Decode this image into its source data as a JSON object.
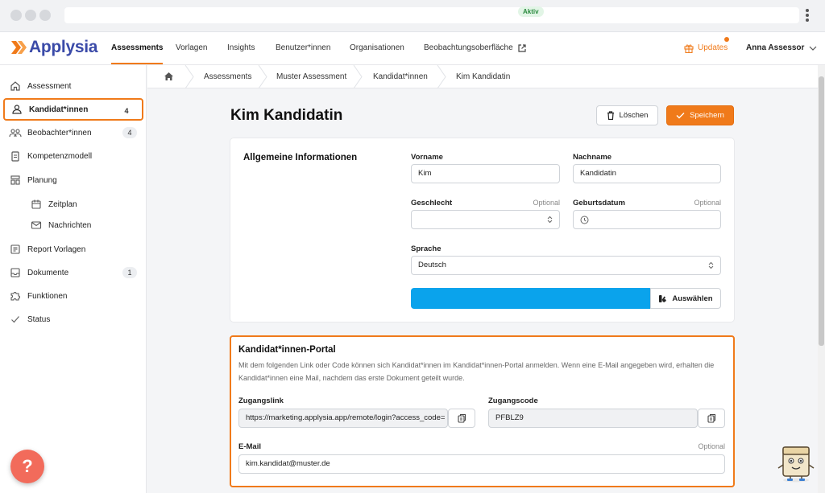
{
  "brand": {
    "name": "Applysia",
    "accent": "#f07a1a",
    "logo_color": "#3a4aa8"
  },
  "topnav": {
    "items": [
      "Assessments",
      "Vorlagen",
      "Insights",
      "Benutzer*innen",
      "Organisationen",
      "Beobachtungsoberfläche"
    ],
    "active": "Assessments",
    "updates_label": "Updates",
    "user_name": "Anna Assessor"
  },
  "sidebar": {
    "items": [
      {
        "label": "Assessment",
        "icon": "home-icon"
      },
      {
        "label": "Kandidat*innen",
        "icon": "users-icon",
        "count": "4",
        "active": true
      },
      {
        "label": "Beobachter*innen",
        "icon": "group-icon",
        "count": "4"
      },
      {
        "label": "Kompetenzmodell",
        "icon": "clipboard-icon"
      },
      {
        "label": "Planung",
        "icon": "layout-icon"
      },
      {
        "label": "Zeitplan",
        "icon": "calendar-icon",
        "sub": true
      },
      {
        "label": "Nachrichten",
        "icon": "mail-icon",
        "sub": true
      },
      {
        "label": "Report Vorlagen",
        "icon": "report-icon"
      },
      {
        "label": "Dokumente",
        "icon": "inbox-icon",
        "count": "1"
      },
      {
        "label": "Funktionen",
        "icon": "puzzle-icon"
      },
      {
        "label": "Status",
        "icon": "check-icon"
      }
    ],
    "help_label": "?"
  },
  "breadcrumb": {
    "items": [
      "Assessments",
      "Muster Assessment",
      "Kandidat*innen",
      "Kim Kandidatin"
    ],
    "status_badge": "Aktiv"
  },
  "page": {
    "title": "Kim Kandidatin",
    "delete_label": "Löschen",
    "save_label": "Speichern"
  },
  "general": {
    "title": "Allgemeine Informationen",
    "vorname_label": "Vorname",
    "vorname_value": "Kim",
    "nachname_label": "Nachname",
    "nachname_value": "Kandidatin",
    "geschlecht_label": "Geschlecht",
    "geschlecht_optional": "Optional",
    "geburtsdatum_label": "Geburtsdatum",
    "geburtsdatum_optional": "Optional",
    "sprache_label": "Sprache",
    "sprache_value": "Deutsch",
    "select_label": "Auswählen"
  },
  "portal": {
    "title": "Kandidat*innen-Portal",
    "description": "Mit dem folgenden Link oder Code können sich Kandidat*innen im Kandidat*innen-Portal anmelden. Wenn eine E-Mail angegeben wird, erhalten die Kandidat*innen eine Mail, nachdem das erste Dokument geteilt wurde.",
    "link_label": "Zugangslink",
    "link_value": "https://marketing.applysia.app/remote/login?access_code=",
    "code_label": "Zugangscode",
    "code_value": "PFBLZ9",
    "email_label": "E-Mail",
    "email_optional": "Optional",
    "email_value": "kim.kandidat@muster.de"
  }
}
